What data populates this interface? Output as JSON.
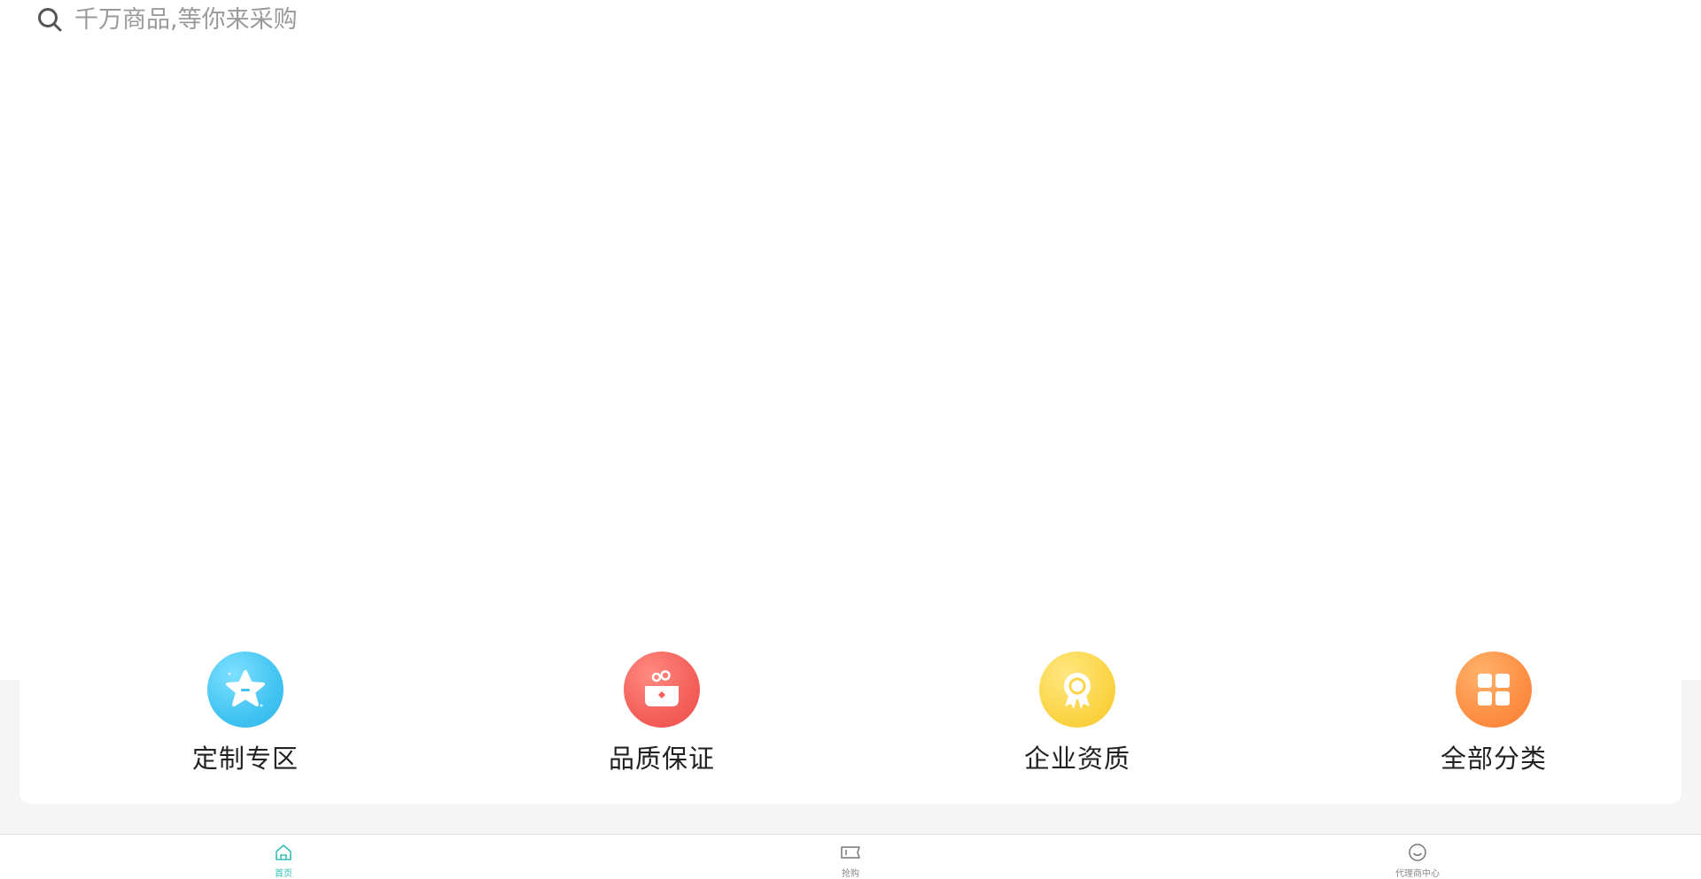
{
  "search": {
    "placeholder": "千万商品,等你来采购",
    "icon": "search-icon"
  },
  "quick_entries": [
    {
      "label": "定制专区",
      "icon": "star-icon",
      "color": "#42c4f2"
    },
    {
      "label": "品质保证",
      "icon": "gift-box-icon",
      "color": "#f4605a"
    },
    {
      "label": "企业资质",
      "icon": "certificate-icon",
      "color": "#fbd547"
    },
    {
      "label": "全部分类",
      "icon": "grid-icon",
      "color": "#fd8f43"
    }
  ],
  "tab_bar": {
    "active_color": "#33c0b5",
    "inactive_color": "#888888",
    "items": [
      {
        "label": "首页",
        "icon": "home-icon",
        "active": true
      },
      {
        "label": "抢购",
        "icon": "ticket-icon",
        "active": false
      },
      {
        "label": "代理商中心",
        "icon": "smile-icon",
        "active": false
      }
    ]
  }
}
